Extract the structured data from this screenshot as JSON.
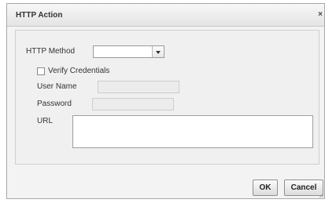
{
  "dialog": {
    "title": "HTTP Action",
    "close_glyph": "×"
  },
  "form": {
    "http_method_label": "HTTP Method",
    "http_method_value": "",
    "verify_credentials_label": "Verify Credentials",
    "verify_credentials_checked": false,
    "user_name_label": "User Name",
    "user_name_value": "",
    "password_label": "Password",
    "password_value": "",
    "url_label": "URL",
    "url_value": ""
  },
  "buttons": {
    "ok_label": "OK",
    "cancel_label": "Cancel"
  },
  "icons": {
    "close": "close-icon",
    "dropdown": "chevron-down-icon",
    "resize": "resize-grip-icon"
  },
  "colors": {
    "title_bar": "#e9e9e9",
    "dialog_bg": "#f3f3f3",
    "button_bg": "#e6e6e6"
  }
}
